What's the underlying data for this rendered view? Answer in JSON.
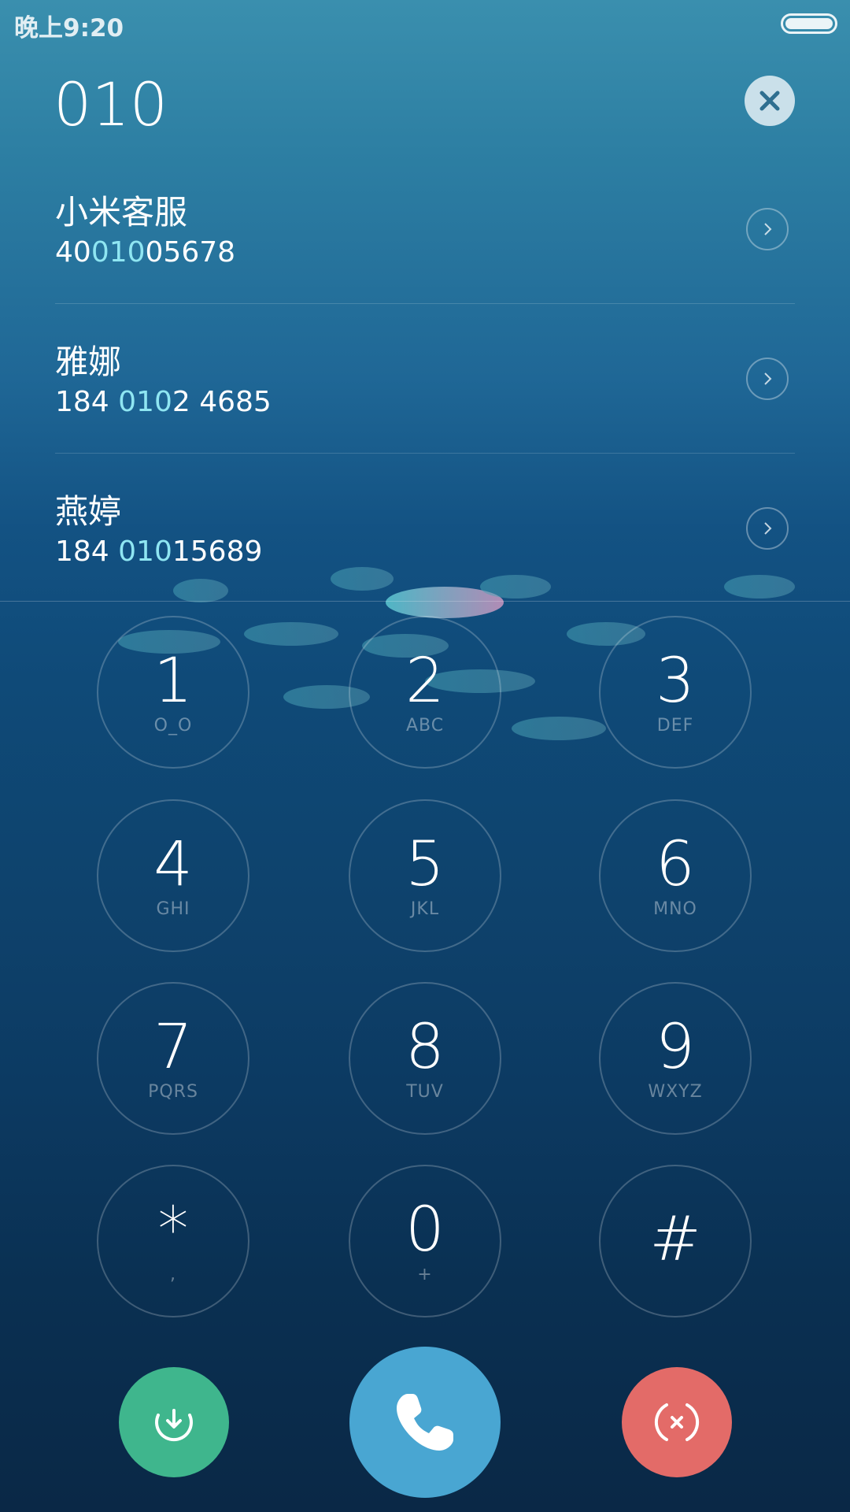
{
  "status_bar": {
    "time": "晚上9:20",
    "battery_icon": "battery-full-icon"
  },
  "header": {
    "dialed_number": "010",
    "clear_icon": "close-icon"
  },
  "results": [
    {
      "name": "小米客服",
      "number_parts": [
        "40",
        "010",
        "05678"
      ],
      "icon": "chevron-right-icon"
    },
    {
      "name": "雅娜",
      "number_parts": [
        "184 ",
        "010",
        "2 4685"
      ],
      "icon": "chevron-right-icon"
    },
    {
      "name": "燕婷",
      "number_parts": [
        "184 ",
        "010",
        "15689"
      ],
      "icon": "chevron-right-icon"
    }
  ],
  "keypad": [
    {
      "digit": "1",
      "letters": "O_O"
    },
    {
      "digit": "2",
      "letters": "ABC"
    },
    {
      "digit": "3",
      "letters": "DEF"
    },
    {
      "digit": "4",
      "letters": "GHI"
    },
    {
      "digit": "5",
      "letters": "JKL"
    },
    {
      "digit": "6",
      "letters": "MNO"
    },
    {
      "digit": "7",
      "letters": "PQRS"
    },
    {
      "digit": "8",
      "letters": "TUV"
    },
    {
      "digit": "9",
      "letters": "WXYZ"
    },
    {
      "digit": "*",
      "letters": ","
    },
    {
      "digit": "0",
      "letters": "+"
    },
    {
      "digit": "#",
      "letters": ""
    }
  ],
  "actions": {
    "save_icon": "download-icon",
    "call_icon": "phone-icon",
    "cancel_icon": "cancel-icon"
  },
  "colors": {
    "highlight": "#8fe6f2",
    "save": "#3fb68d",
    "call": "#49a6d2",
    "cancel": "#e36b68"
  }
}
